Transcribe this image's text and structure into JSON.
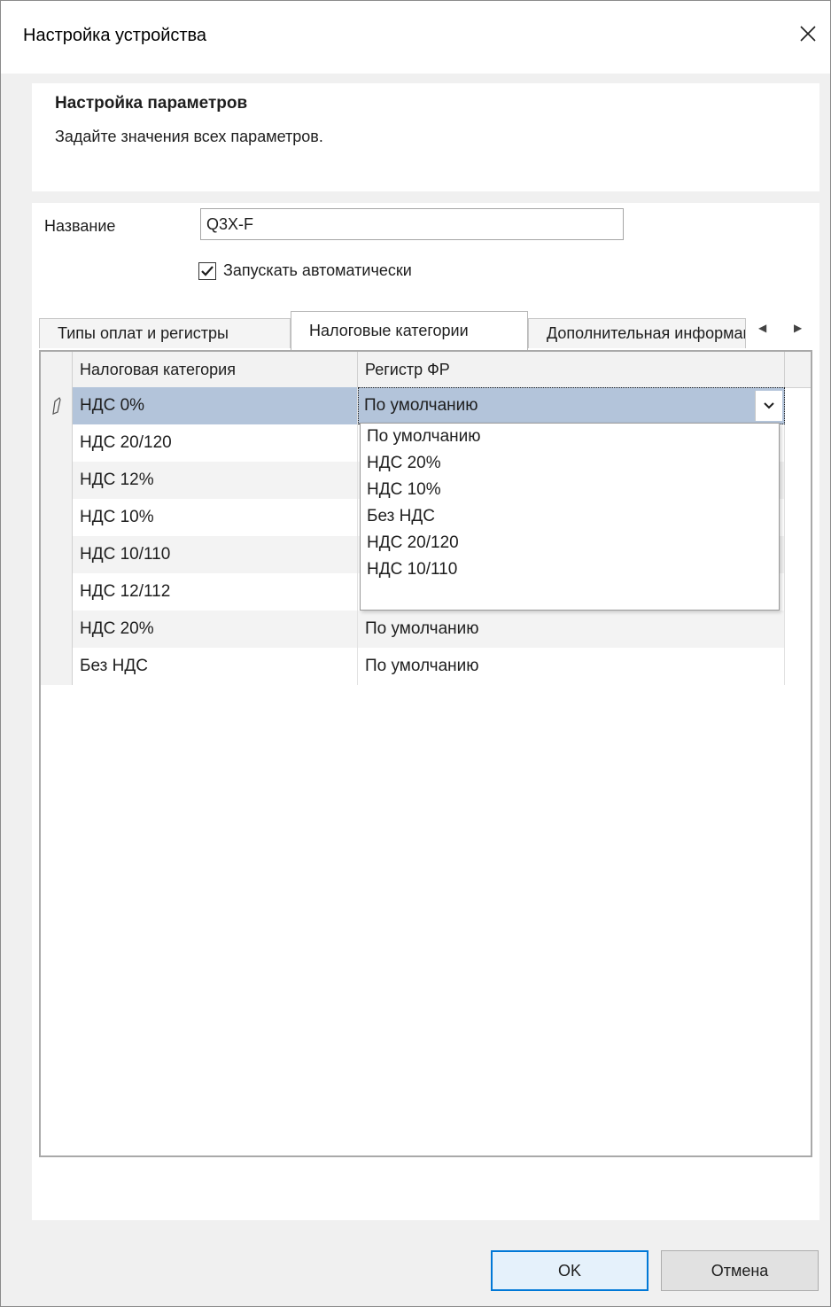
{
  "window": {
    "title": "Настройка устройства"
  },
  "header": {
    "title": "Настройка параметров",
    "subtitle": "Задайте значения всех параметров."
  },
  "form": {
    "name_label": "Название",
    "name_value": "Q3X-F",
    "autostart_label": "Запускать автоматически",
    "autostart_checked": true
  },
  "tabs": [
    {
      "label": "Типы оплат и регистры",
      "active": false
    },
    {
      "label": "Налоговые категории",
      "active": true
    },
    {
      "label": "Дополнительная информация",
      "active": false
    }
  ],
  "grid": {
    "columns": [
      "Налоговая категория",
      "Регистр ФР"
    ],
    "rows": [
      {
        "category": "НДС 0%",
        "register": "По умолчанию"
      },
      {
        "category": "НДС 20/120",
        "register": ""
      },
      {
        "category": "НДС 12%",
        "register": ""
      },
      {
        "category": "НДС 10%",
        "register": ""
      },
      {
        "category": "НДС 10/110",
        "register": ""
      },
      {
        "category": "НДС 12/112",
        "register": ""
      },
      {
        "category": "НДС 20%",
        "register": "По умолчанию"
      },
      {
        "category": "Без НДС",
        "register": "По умолчанию"
      }
    ]
  },
  "dropdown": {
    "options": [
      "По умолчанию",
      "НДС 20%",
      "НДС 10%",
      "Без НДС",
      "НДС 20/120",
      "НДС 10/110"
    ]
  },
  "buttons": {
    "ok": "OK",
    "cancel": "Отмена"
  }
}
